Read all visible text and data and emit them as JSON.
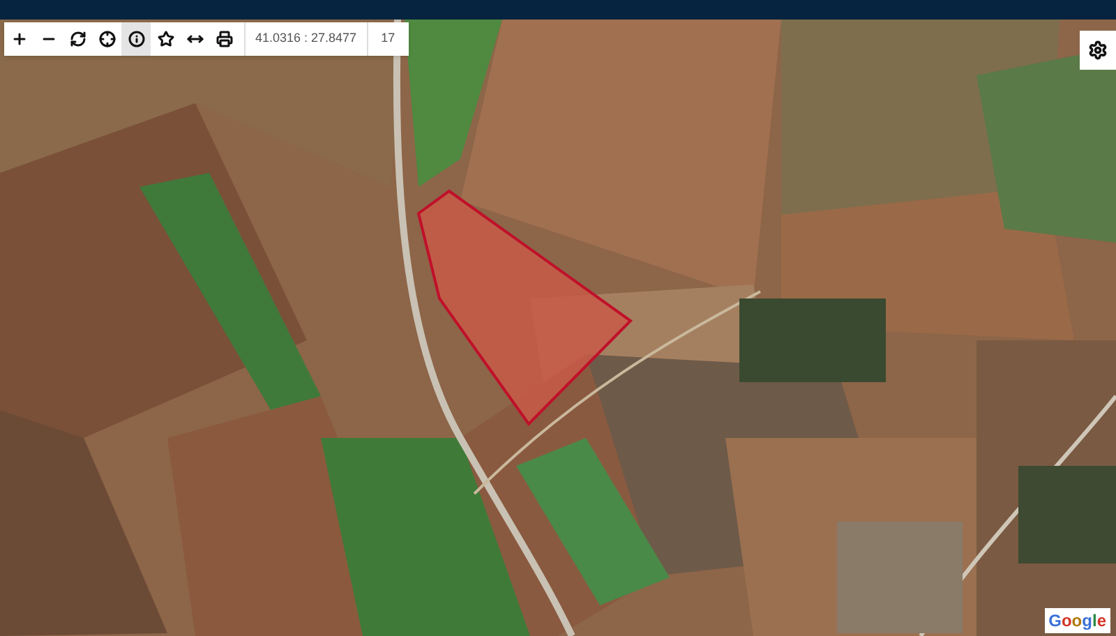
{
  "map_toolbar": {
    "tools": [
      {
        "selected": false
      },
      {
        "selected": false
      },
      {
        "selected": false
      },
      {
        "selected": false
      },
      {
        "selected": true
      },
      {
        "selected": false
      },
      {
        "selected": false
      },
      {
        "selected": false
      }
    ],
    "coordinates": "41.0316 : 27.8477",
    "zoom": "17"
  },
  "map": {
    "attribution": "Google"
  }
}
